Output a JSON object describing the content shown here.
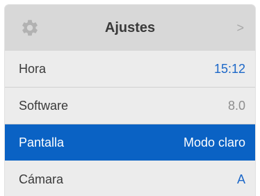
{
  "header": {
    "title": "Ajustes",
    "left_icon": "gear-icon",
    "right_icon": "chevron-right-icon",
    "chevron": ">"
  },
  "rows": [
    {
      "label": "Hora",
      "value": "15:12",
      "value_color": "#1b67c8",
      "selected": false
    },
    {
      "label": "Software",
      "value": "8.0",
      "value_color": "#8e8e8e",
      "selected": false
    },
    {
      "label": "Pantalla",
      "value": "Modo claro",
      "value_color": "#ffffff",
      "selected": true
    },
    {
      "label": "Cámara",
      "value": "A",
      "value_color": "#1b67c8",
      "selected": false
    }
  ],
  "colors": {
    "selection": "#0a62c4",
    "accent": "#1b67c8",
    "header_bg": "#d8d8d8",
    "row_bg": "#ececec"
  }
}
